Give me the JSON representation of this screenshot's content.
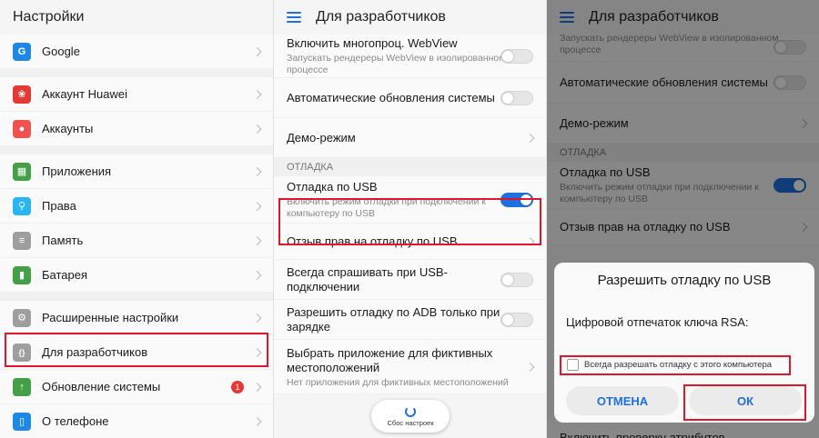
{
  "panel1": {
    "title": "Настройки",
    "items": [
      {
        "label": "Google",
        "icon": "google-icon",
        "glyph": "G",
        "color": "#1e88e5"
      },
      {
        "label": "Аккаунт Huawei",
        "icon": "huawei-icon",
        "glyph": "❀",
        "color": "#e53935"
      },
      {
        "label": "Аккаунты",
        "icon": "accounts-icon",
        "glyph": "●",
        "color": "#ef5350"
      },
      {
        "label": "Приложения",
        "icon": "apps-icon",
        "glyph": "▦",
        "color": "#43a047"
      },
      {
        "label": "Права",
        "icon": "key-icon",
        "glyph": "⚲",
        "color": "#29b6f6"
      },
      {
        "label": "Память",
        "icon": "memory-icon",
        "glyph": "≡",
        "color": "#9e9e9e"
      },
      {
        "label": "Батарея",
        "icon": "battery-icon",
        "glyph": "▮",
        "color": "#43a047"
      },
      {
        "label": "Расширенные настройки",
        "icon": "gear-icon",
        "glyph": "⚙",
        "color": "#9e9e9e"
      },
      {
        "label": "Для разработчиков",
        "icon": "developer-icon",
        "glyph": "{}",
        "color": "#9e9e9e"
      },
      {
        "label": "Обновление системы",
        "icon": "update-icon",
        "glyph": "↑",
        "color": "#43a047",
        "badge": "1"
      },
      {
        "label": "О телефоне",
        "icon": "phone-icon",
        "glyph": "▯",
        "color": "#1e88e5"
      }
    ]
  },
  "panel2": {
    "title": "Для разработчиков",
    "rows": [
      {
        "title": "Включить многопроц. WebView",
        "sub": "Запускать рендереры WebView в изолированном процессе"
      },
      {
        "title": "Автоматические обновления системы"
      },
      {
        "title": "Демо-режим"
      },
      {
        "title": "Отладка по USB",
        "sub": "Включить режим отладки при подключении к компьютеру по USB"
      },
      {
        "title": "Отзыв прав на отладку по USB"
      },
      {
        "title": "Всегда спрашивать при USB-подключении"
      },
      {
        "title": "Разрешить отладку по ADB только при зарядке"
      },
      {
        "title": "Выбрать приложение для фиктивных местоположений",
        "sub": "Нет приложения для фиктивных местоположений"
      }
    ],
    "section": "ОТЛАДКА",
    "toast": "Сбос настроек"
  },
  "panel3": {
    "title": "Для разработчиков",
    "rows": [
      {
        "title": "",
        "sub": "Запускать рендереры WebView в изолированном процессе"
      },
      {
        "title": "Автоматические обновления системы"
      },
      {
        "title": "Демо-режим"
      },
      {
        "title": "Отладка по USB",
        "sub": "Включить режим отладки при подключении к компьютеру по USB"
      },
      {
        "title": "Отзыв прав на отладку по USB"
      },
      {
        "title": "Включить проверку атрибутов"
      }
    ],
    "section": "ОТЛАДКА",
    "dialog": {
      "title": "Разрешить отладку по USB",
      "text": "Цифровой отпечаток ключа RSA:",
      "checkbox": "Всегда разрешать отладку с этого компьютера",
      "cancel": "ОТМЕНА",
      "ok": "ОК"
    }
  },
  "colors": {
    "accent": "#1e6fe0",
    "highlight": "#e0162b",
    "badge": "#e53935"
  }
}
